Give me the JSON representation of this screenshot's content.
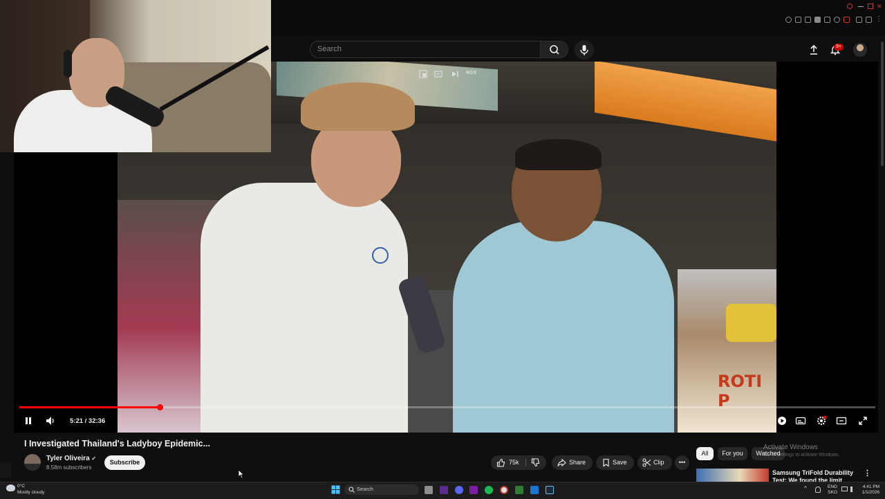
{
  "colors": {
    "accent": "#ff0000",
    "background": "#0f0f0f",
    "notification_badge": "#cc0000"
  },
  "header": {
    "search_placeholder": "Search",
    "notifications_badge": "9+",
    "icons": [
      "search-icon",
      "mic-icon",
      "upload-icon",
      "bell-icon",
      "avatar"
    ]
  },
  "player": {
    "time": "5:21 / 32:36",
    "progress_fraction": 0.164,
    "overlay_label": "RGX"
  },
  "video": {
    "title": "I Investigated Thailand's Ladyboy Epidemic...",
    "sign_text": "ROTI P"
  },
  "channel": {
    "name": "Tyler Oliveira",
    "subscribers": "8.58m subscribers",
    "subscribe_label": "Subscribe"
  },
  "actions": {
    "likes": "75k",
    "share": "Share",
    "save": "Save",
    "clip": "Clip"
  },
  "recommend": {
    "chips": [
      "All",
      "For you",
      "Watched"
    ],
    "next_title_line1": "Samsung TriFold Durability",
    "next_title_line2": "Test: We found the limit"
  },
  "watermark": {
    "line1": "Activate Windows",
    "line2": "Go to Settings to activate Windows."
  },
  "taskbar": {
    "weather_temp": "0°C",
    "weather_desc": "Mostly cloudy",
    "search_label": "Search",
    "lang_line1": "ENG",
    "lang_line2": "SKO",
    "time": "4:41 PM",
    "date": "1/1/2026"
  }
}
